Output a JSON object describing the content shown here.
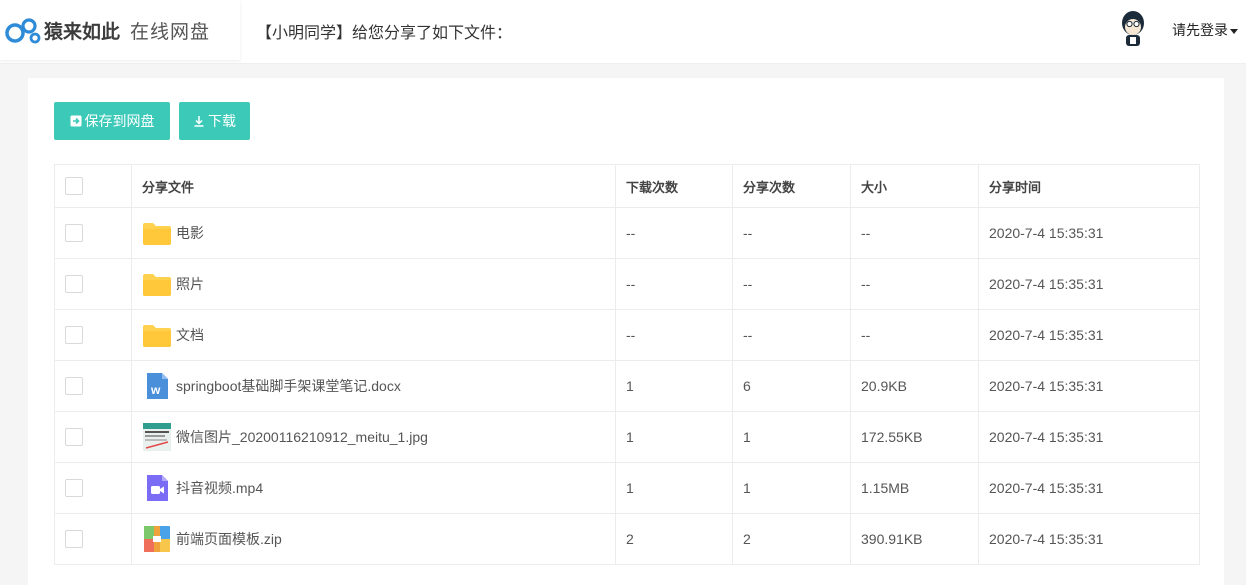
{
  "header": {
    "brand": "猿来如此",
    "brand_sub": "在线网盘",
    "share_message": "【小明同学】给您分享了如下文件：",
    "login_label": "请先登录"
  },
  "toolbar": {
    "save_label": "保存到网盘",
    "download_label": "下载"
  },
  "table": {
    "columns": [
      "分享文件",
      "下载次数",
      "分享次数",
      "大小",
      "分享时间"
    ],
    "rows": [
      {
        "name": "电影",
        "icon": "folder-icon",
        "downloads": "--",
        "shares": "--",
        "size": "--",
        "time": "2020-7-4 15:35:31"
      },
      {
        "name": "照片",
        "icon": "folder-icon",
        "downloads": "--",
        "shares": "--",
        "size": "--",
        "time": "2020-7-4 15:35:31"
      },
      {
        "name": "文档",
        "icon": "folder-icon",
        "downloads": "--",
        "shares": "--",
        "size": "--",
        "time": "2020-7-4 15:35:31"
      },
      {
        "name": "springboot基础脚手架课堂笔记.docx",
        "icon": "word-icon",
        "downloads": "1",
        "shares": "6",
        "size": "20.9KB",
        "time": "2020-7-4 15:35:31"
      },
      {
        "name": "微信图片_20200116210912_meitu_1.jpg",
        "icon": "image-thumb-icon",
        "downloads": "1",
        "shares": "1",
        "size": "172.55KB",
        "time": "2020-7-4 15:35:31"
      },
      {
        "name": "抖音视频.mp4",
        "icon": "video-icon",
        "downloads": "1",
        "shares": "1",
        "size": "1.15MB",
        "time": "2020-7-4 15:35:31"
      },
      {
        "name": "前端页面模板.zip",
        "icon": "zip-icon",
        "downloads": "2",
        "shares": "2",
        "size": "390.91KB",
        "time": "2020-7-4 15:35:31"
      }
    ]
  },
  "colors": {
    "accent": "#3cc9b8",
    "folder": "#ffd14f",
    "word": "#4a8fd9",
    "video": "#7b6cf6"
  }
}
